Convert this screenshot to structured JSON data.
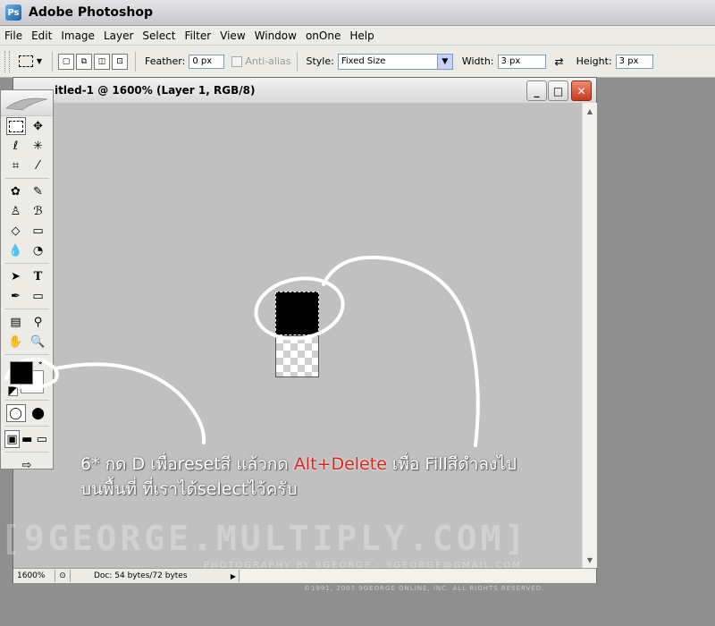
{
  "app": {
    "title": "Adobe Photoshop",
    "icon": "photoshop-icon"
  },
  "menu": [
    "File",
    "Edit",
    "Image",
    "Layer",
    "Select",
    "Filter",
    "View",
    "Window",
    "onOne",
    "Help"
  ],
  "options": {
    "feather_label": "Feather:",
    "feather_value": "0 px",
    "antialias_label": "Anti-alias",
    "style_label": "Style:",
    "style_value": "Fixed Size",
    "width_label": "Width:",
    "width_value": "3 px",
    "height_label": "Height:",
    "height_value": "3 px"
  },
  "document": {
    "title": "itled-1 @ 1600% (Layer 1, RGB/8)",
    "zoom": "1600%",
    "doc_info": "Doc: 54 bytes/72 bytes"
  },
  "colors": {
    "foreground": "#000000",
    "background": "#ffffff",
    "highlight": "#d8271f"
  },
  "instruction": {
    "line1_a": "6* กด D เพื่อresetสี แล้วกด ",
    "line1_key": "Alt+Delete",
    "line1_b": " เพื่อ Fillสีดำลงไป",
    "line2": "บนพื้นที่ ที่เราได้selectไว้ครับ"
  },
  "watermark": {
    "main": "[9GEORGE.MULTIPLY.COM]",
    "sub": "PHOTOGRAPHY BY 9GEORGE : 9GEORGE@GMAIL.COM",
    "copyright": "©1991, 2007 9GEORGE ONLINE, INC. ALL RIGHTS RESERVED."
  }
}
